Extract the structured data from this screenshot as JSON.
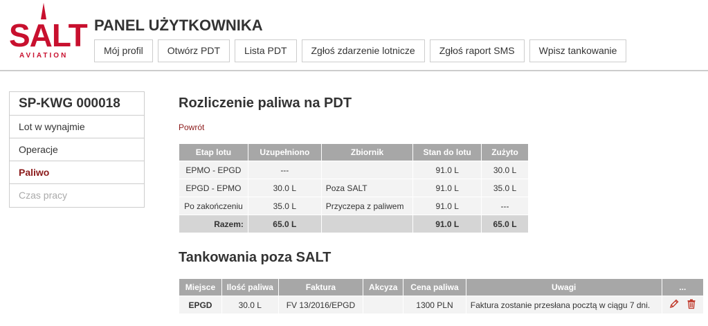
{
  "brand": {
    "logo_text": "SALT",
    "logo_sub": "AVIATION",
    "accent": "#c8102e",
    "link_color": "#8b1a1a"
  },
  "header": {
    "title": "PANEL UŻYTKOWNIKA",
    "nav": [
      "Mój profil",
      "Otwórz PDT",
      "Lista PDT",
      "Zgłoś zdarzenie lotnicze",
      "Zgłoś raport SMS",
      "Wpisz tankowanie"
    ]
  },
  "sidebar": {
    "title": "SP-KWG 000018",
    "items": [
      {
        "label": "Lot w wynajmie"
      },
      {
        "label": "Operacje"
      },
      {
        "label": "Paliwo"
      },
      {
        "label": "Czas pracy"
      }
    ]
  },
  "main": {
    "heading": "Rozliczenie paliwa na PDT",
    "back": "Powrót",
    "fuel_table": {
      "headers": [
        "Etap lotu",
        "Uzupełniono",
        "Zbiornik",
        "Stan do lotu",
        "Zużyto"
      ],
      "rows": [
        [
          "EPMO - EPGD",
          "---",
          "",
          "91.0 L",
          "30.0 L"
        ],
        [
          "EPGD - EPMO",
          "30.0 L",
          "Poza SALT",
          "91.0 L",
          "35.0 L"
        ],
        [
          "Po zakończeniu",
          "35.0 L",
          "Przyczepa z paliwem",
          "91.0 L",
          "---"
        ]
      ],
      "total": [
        "Razem:",
        "65.0 L",
        "",
        "91.0 L",
        "65.0 L"
      ]
    },
    "outside_heading": "Tankowania poza SALT",
    "outside_table": {
      "headers": [
        "Miejsce",
        "Ilość paliwa",
        "Faktura",
        "Akcyza",
        "Cena paliwa",
        "Uwagi",
        "..."
      ],
      "rows": [
        [
          "EPGD",
          "30.0 L",
          "FV 13/2016/EPGD",
          "",
          "1300 PLN",
          "Faktura zostanie przesłana pocztą w ciągu 7 dni."
        ]
      ],
      "row_icons": [
        "pencil-icon",
        "trash-icon"
      ]
    }
  }
}
